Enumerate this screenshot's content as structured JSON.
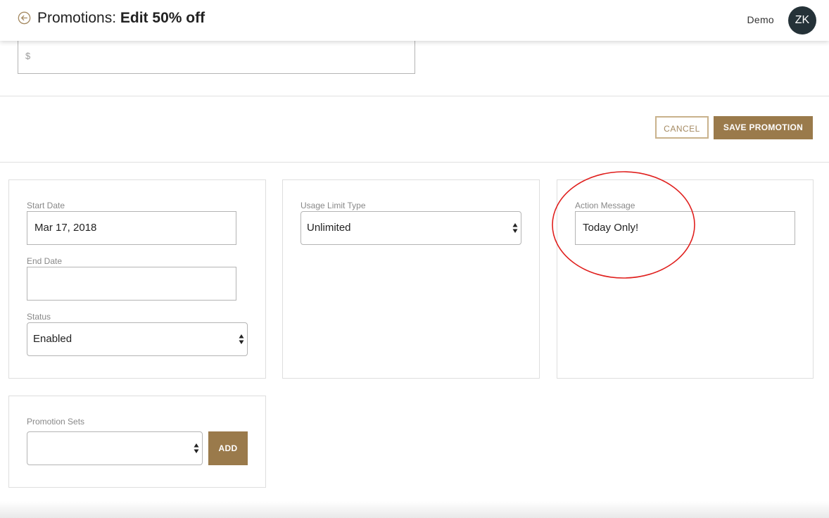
{
  "header": {
    "title_prefix": "Promotions: ",
    "title_name": "Edit 50% off",
    "user_name": "Demo",
    "avatar_initials": "ZK"
  },
  "price": {
    "prefix": "$",
    "value": ""
  },
  "actions": {
    "cancel_label": "CANCEL",
    "save_label": "SAVE PROMOTION"
  },
  "dates": {
    "start_label": "Start Date",
    "start_value": "Mar 17, 2018",
    "end_label": "End Date",
    "end_value": "",
    "status_label": "Status",
    "status_value": "Enabled"
  },
  "usage": {
    "label": "Usage Limit Type",
    "value": "Unlimited"
  },
  "message": {
    "label": "Action Message",
    "value": "Today Only!"
  },
  "promotion_sets": {
    "label": "Promotion Sets",
    "value": "",
    "add_label": "ADD"
  },
  "colors": {
    "accent": "#9a7a4b",
    "accent_light": "#c9b28c",
    "avatar_bg": "#253238",
    "highlight": "#e0201e"
  },
  "icons": {
    "back": "back-arrow-circle-icon",
    "select": "select-arrows-icon"
  }
}
